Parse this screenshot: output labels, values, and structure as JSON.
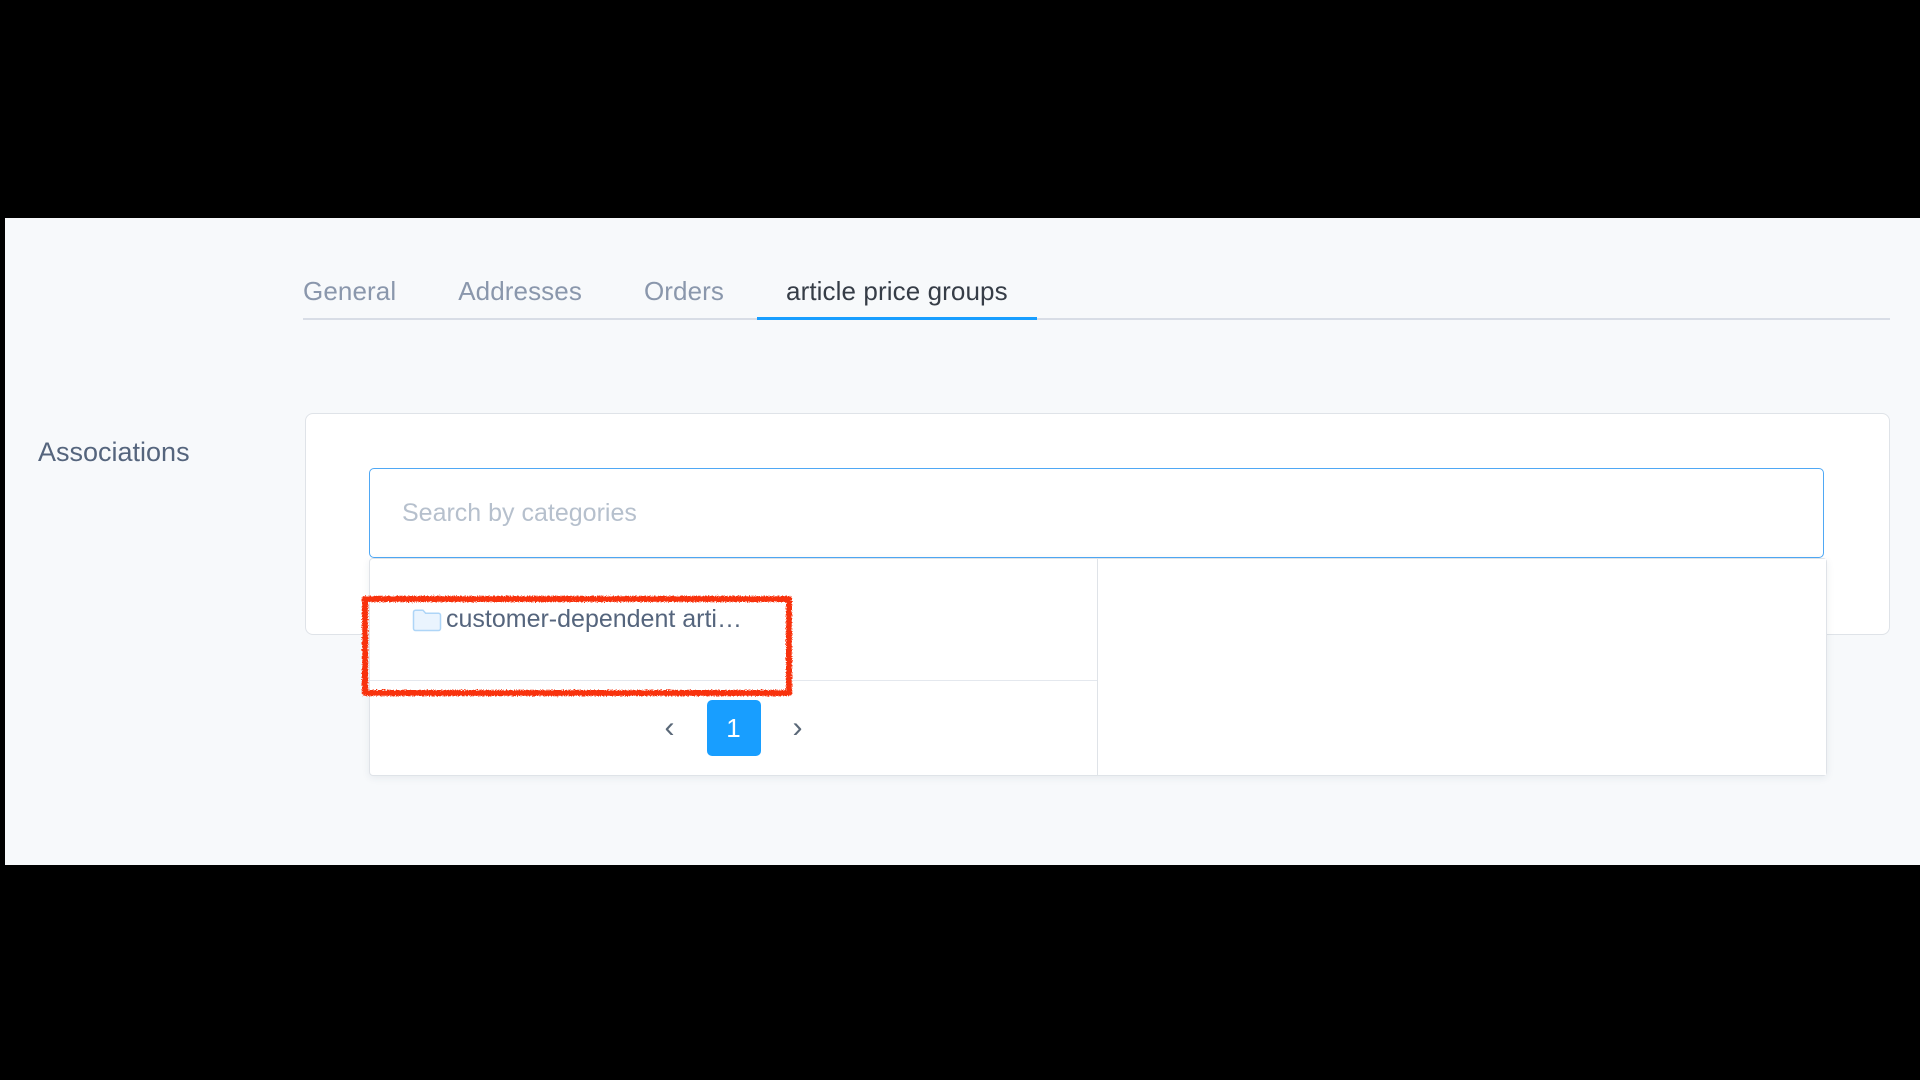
{
  "tabs": [
    {
      "label": "General",
      "active": false
    },
    {
      "label": "Addresses",
      "active": false
    },
    {
      "label": "Orders",
      "active": false
    },
    {
      "label": "article price groups",
      "active": true
    }
  ],
  "associations": {
    "section_label": "Associations",
    "search": {
      "placeholder": "Search by categories",
      "value": ""
    },
    "dropdown": {
      "items": [
        {
          "label": "customer-dependent arti…",
          "icon": "folder-icon"
        }
      ],
      "pagination": {
        "prev_label": "‹",
        "next_label": "›",
        "pages": [
          "1"
        ],
        "current_page": "1"
      }
    }
  },
  "colors": {
    "accent": "#189eff",
    "page_background": "#f7f9fb",
    "card_background": "#ffffff",
    "border": "#dfe3e8",
    "tab_inactive_text": "#8a97ac",
    "tab_active_text": "#363d47",
    "label_text": "#55657d",
    "placeholder_text": "#b6c0cd",
    "annotation": "#f8330f",
    "letterbox": "#000000"
  }
}
